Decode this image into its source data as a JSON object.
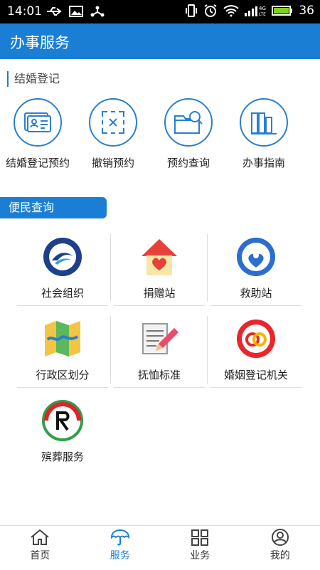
{
  "status": {
    "time": "14:01",
    "battery": "36",
    "network": "4G LTE"
  },
  "appbar": {
    "title": "办事服务"
  },
  "section1": {
    "title": "结婚登记",
    "items": [
      {
        "label": "结婚登记预约",
        "icon": "id-card-icon"
      },
      {
        "label": "撤销预约",
        "icon": "cancel-box-icon"
      },
      {
        "label": "预约查询",
        "icon": "folder-search-icon"
      },
      {
        "label": "办事指南",
        "icon": "books-icon"
      }
    ]
  },
  "section2": {
    "title": "便民查询",
    "items": [
      {
        "label": "社会组织"
      },
      {
        "label": "捐赠站"
      },
      {
        "label": "救助站"
      },
      {
        "label": "行政区划分"
      },
      {
        "label": "抚恤标准"
      },
      {
        "label": "婚姻登记机关"
      },
      {
        "label": "殡葬服务"
      }
    ]
  },
  "tabs": [
    {
      "label": "首页"
    },
    {
      "label": "服务"
    },
    {
      "label": "业务"
    },
    {
      "label": "我的"
    }
  ],
  "colors": {
    "primary": "#1a7fd4"
  }
}
